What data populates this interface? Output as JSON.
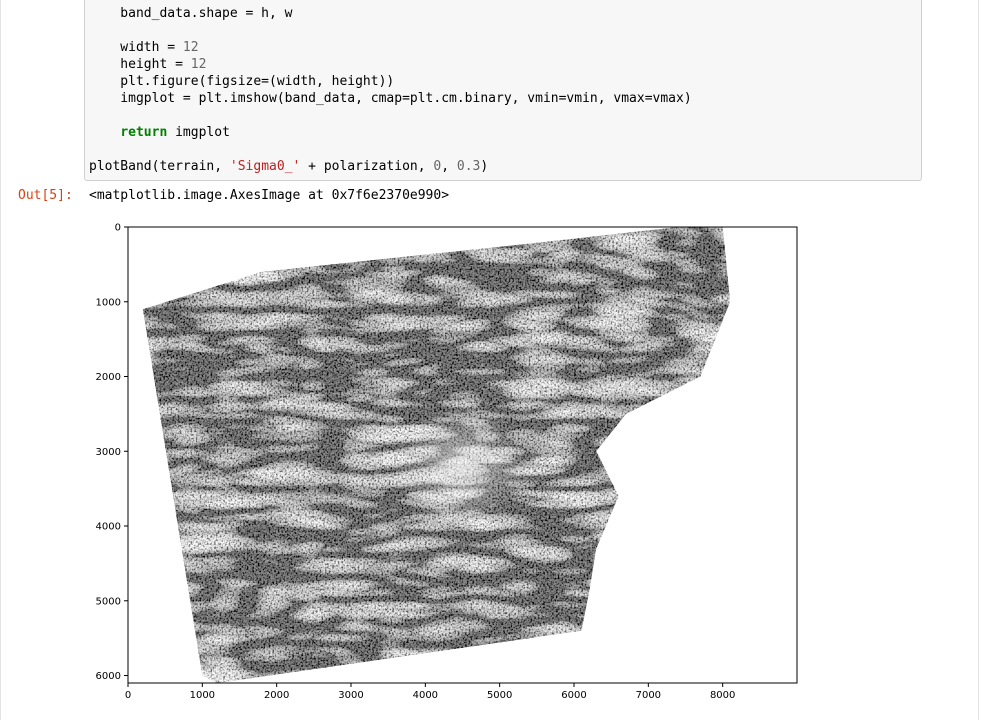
{
  "code_lines": [
    {
      "segments": [
        {
          "t": "    band_data.shape = h, w",
          "c": ""
        }
      ]
    },
    {
      "segments": [
        {
          "t": "",
          "c": ""
        }
      ]
    },
    {
      "segments": [
        {
          "t": "    width = ",
          "c": ""
        },
        {
          "t": "12",
          "c": "num"
        }
      ]
    },
    {
      "segments": [
        {
          "t": "    height = ",
          "c": ""
        },
        {
          "t": "12",
          "c": "num"
        }
      ]
    },
    {
      "segments": [
        {
          "t": "    plt.figure(figsize=(width, height))",
          "c": ""
        }
      ]
    },
    {
      "segments": [
        {
          "t": "    imgplot = plt.imshow(band_data, cmap=plt.cm.binary, vmin=vmin, vmax=vmax)",
          "c": ""
        }
      ]
    },
    {
      "segments": [
        {
          "t": "",
          "c": ""
        }
      ]
    },
    {
      "segments": [
        {
          "t": "    ",
          "c": ""
        },
        {
          "t": "return",
          "c": "kw"
        },
        {
          "t": " imgplot",
          "c": ""
        }
      ]
    },
    {
      "segments": [
        {
          "t": "",
          "c": ""
        }
      ]
    },
    {
      "segments": [
        {
          "t": "plotBand(terrain, ",
          "c": ""
        },
        {
          "t": "'Sigma0_'",
          "c": "str"
        },
        {
          "t": " + polarization, ",
          "c": ""
        },
        {
          "t": "0",
          "c": "num"
        },
        {
          "t": ", ",
          "c": ""
        },
        {
          "t": "0.3",
          "c": "num"
        },
        {
          "t": ")",
          "c": ""
        }
      ]
    }
  ],
  "output": {
    "prompt": "Out[5]:",
    "text": "<matplotlib.image.AxesImage at 0x7f6e2370e990>"
  },
  "chart_data": {
    "type": "heatmap",
    "title": "",
    "xlabel": "",
    "ylabel": "",
    "colormap": "binary",
    "vmin": 0,
    "vmax": 0.3,
    "xlim": [
      0,
      9000
    ],
    "ylim": [
      6100,
      0
    ],
    "x_ticks": [
      0,
      1000,
      2000,
      3000,
      4000,
      5000,
      6000,
      7000,
      8000
    ],
    "y_ticks": [
      0,
      1000,
      2000,
      3000,
      4000,
      5000,
      6000
    ],
    "footprint_outline": [
      [
        8000,
        0
      ],
      [
        8100,
        1000
      ],
      [
        7700,
        2000
      ],
      [
        6700,
        2500
      ],
      [
        6300,
        3000
      ],
      [
        6600,
        3600
      ],
      [
        6300,
        4300
      ],
      [
        6200,
        4900
      ],
      [
        6100,
        5400
      ],
      [
        1200,
        6100
      ],
      [
        1000,
        6000
      ],
      [
        200,
        1100
      ],
      [
        1800,
        600
      ],
      [
        5600,
        200
      ],
      [
        7400,
        0
      ]
    ],
    "bright_peak": [
      4500,
      3200
    ],
    "grid": false
  }
}
